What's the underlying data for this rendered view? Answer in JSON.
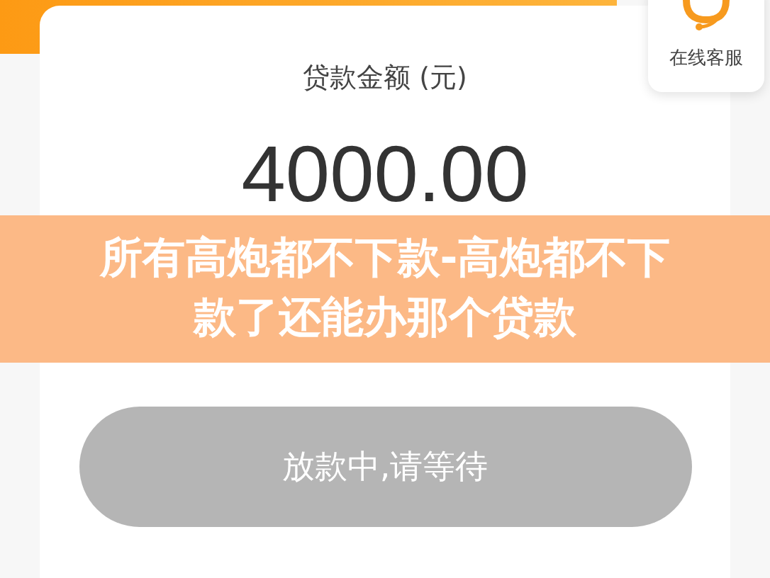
{
  "service": {
    "label": "在线客服"
  },
  "amount_label": "贷款金额 (元)",
  "amount": "4000.00",
  "banner": {
    "title": "所有高炮都不下款-高炮都不下款了还能办那个贷款"
  },
  "button": {
    "label": "放款中,请等待",
    "disabled": true
  }
}
